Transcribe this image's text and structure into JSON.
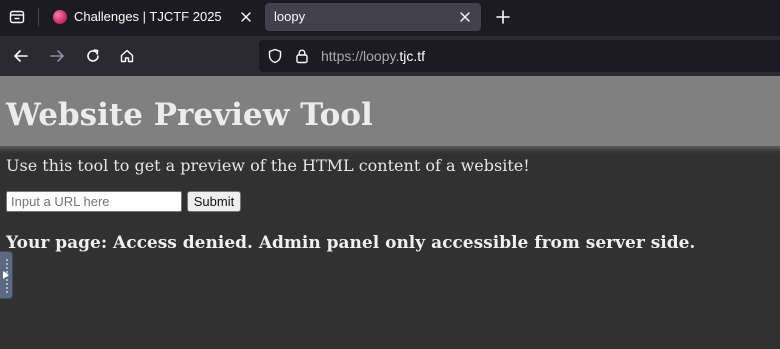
{
  "browser": {
    "tabs": [
      {
        "title": "Challenges | TJCTF 2025",
        "favicon": "tjctf-favicon",
        "active": false
      },
      {
        "title": "loopy",
        "active": true
      }
    ],
    "new_tab_icon": "plus-icon",
    "tab_list_icon": "tab-list-icon",
    "nav": {
      "back_icon": "arrow-left-icon",
      "forward_icon": "arrow-right-icon",
      "reload_icon": "reload-icon",
      "home_icon": "home-icon"
    },
    "url": {
      "prefix": "https://loopy.",
      "host": "tjc.tf",
      "suffix": ""
    }
  },
  "page": {
    "heading": "Website Preview Tool",
    "description": "Use this tool to get a preview of the HTML content of a website!",
    "url_input": {
      "placeholder": "Input a URL here",
      "value": ""
    },
    "submit_label": "Submit",
    "result": "Your page: Access denied. Admin panel only accessible from server side."
  },
  "colors": {
    "tab_strip": "#1c1b22",
    "toolbar": "#2b2a33",
    "active_tab": "#42414d",
    "page_bg": "#313131",
    "banner_gray": "#808080"
  }
}
